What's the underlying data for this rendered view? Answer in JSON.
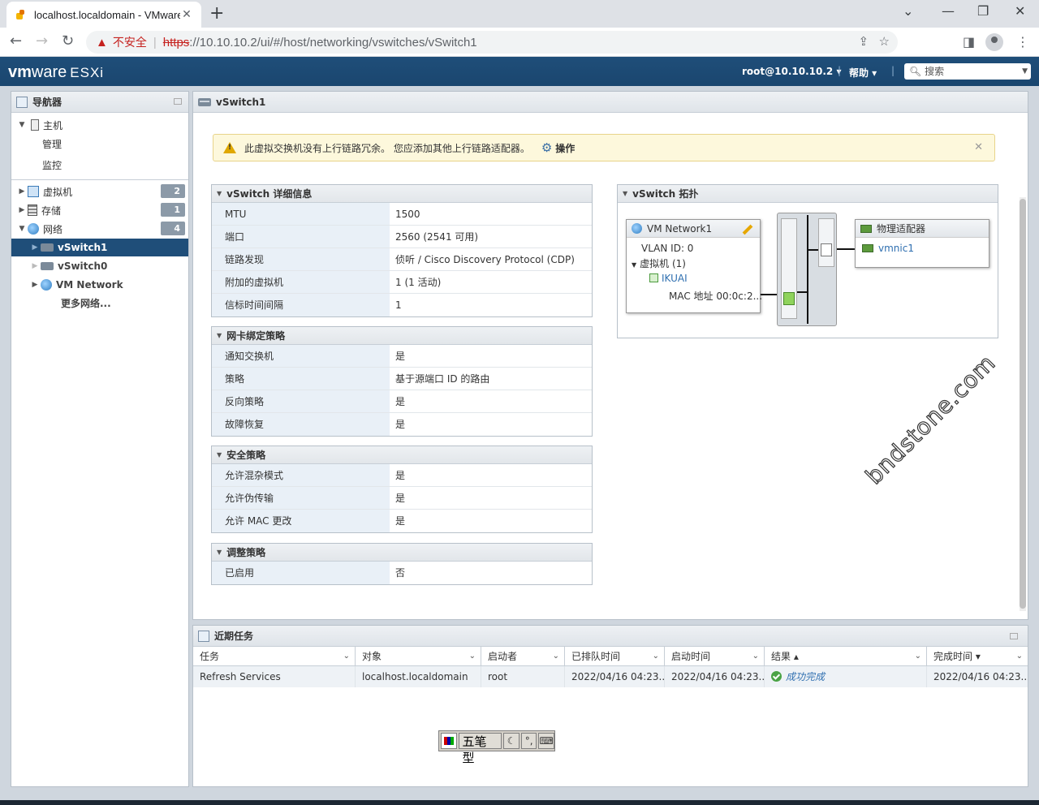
{
  "browser": {
    "tab_title": "localhost.localdomain - VMware",
    "tab_close": "✕",
    "new_tab": "+",
    "security_label": "不安全",
    "url_scheme": "https",
    "url_rest": "://10.10.10.2/ui/#/host/networking/vswitches/vSwitch1"
  },
  "header": {
    "logo_vm": "vm",
    "logo_ware": "ware",
    "logo_product": "ESXi",
    "user": "root@10.10.10.2 ▾",
    "help": "帮助 ▾",
    "search_placeholder": "搜索"
  },
  "navigator": {
    "title": "导航器",
    "host": "主机",
    "manage": "管理",
    "monitor": "监控",
    "vms": "虚拟机",
    "vms_count": "2",
    "storage": "存储",
    "storage_count": "1",
    "network": "网络",
    "network_count": "4",
    "vswitch1": "vSwitch1",
    "vswitch0": "vSwitch0",
    "vm_network": "VM Network",
    "more_networks": "更多网络..."
  },
  "main": {
    "title": "vSwitch1",
    "alert_text": "此虚拟交换机没有上行链路冗余。 您应添加其他上行链路适配器。",
    "alert_actions": "操作",
    "alert_close": "✕",
    "details": {
      "title": "vSwitch 详细信息",
      "rows": [
        {
          "k": "MTU",
          "v": "1500"
        },
        {
          "k": "端口",
          "v": "2560 (2541 可用)"
        },
        {
          "k": "链路发现",
          "v": "侦听 / Cisco Discovery Protocol (CDP)"
        },
        {
          "k": "附加的虚拟机",
          "v": "1 (1 活动)"
        },
        {
          "k": "信标时间间隔",
          "v": "1"
        }
      ]
    },
    "nic_teaming": {
      "title": "网卡绑定策略",
      "rows": [
        {
          "k": "通知交换机",
          "v": "是"
        },
        {
          "k": "策略",
          "v": "基于源端口 ID 的路由"
        },
        {
          "k": "反向策略",
          "v": "是"
        },
        {
          "k": "故障恢复",
          "v": "是"
        }
      ]
    },
    "security": {
      "title": "安全策略",
      "rows": [
        {
          "k": "允许混杂模式",
          "v": "是"
        },
        {
          "k": "允许伪传输",
          "v": "是"
        },
        {
          "k": "允许 MAC 更改",
          "v": "是"
        }
      ]
    },
    "shaping": {
      "title": "调整策略",
      "rows": [
        {
          "k": "已启用",
          "v": "否"
        }
      ]
    },
    "topology": {
      "title": "vSwitch 拓扑",
      "portgroup": "VM Network1",
      "vlan": "VLAN ID: 0",
      "vm_group": "虚拟机 (1)",
      "vm_name": "IKUAI",
      "mac": "MAC 地址 00:0c:2...",
      "adapters_title": "物理适配器",
      "vmnic": "vmnic1"
    }
  },
  "watermark": "bndstone.com",
  "tasks": {
    "title": "近期任务",
    "columns": [
      "任务",
      "对象",
      "启动者",
      "已排队时间",
      "启动时间",
      "结果 ▴",
      "完成时间 ▾"
    ],
    "row": {
      "task": "Refresh Services",
      "object": "localhost.localdomain",
      "initiator": "root",
      "queued": "2022/04/16 04:23...",
      "started": "2022/04/16 04:23...",
      "result": "成功完成",
      "completed": "2022/04/16 04:23..."
    }
  },
  "ime": {
    "name": "五笔型"
  }
}
